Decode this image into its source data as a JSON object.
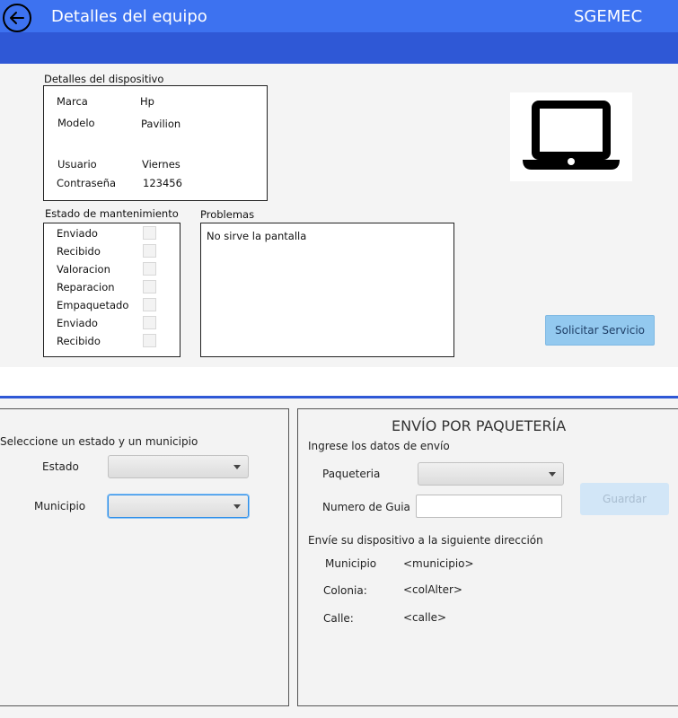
{
  "header": {
    "back_label": "back",
    "title": "Detalles del equipo",
    "brand": "SGEMEC"
  },
  "device": {
    "section_label": "Detalles del dispositivo",
    "marca_label": "Marca",
    "marca_value": "Hp",
    "modelo_label": "Modelo",
    "modelo_value": "Pavilion",
    "usuario_label": "Usuario",
    "usuario_value": "Viernes",
    "password_label": "Contraseña",
    "password_value": "123456",
    "image_icon": "laptop-icon"
  },
  "maintenance": {
    "section_label": "Estado de mantenimiento",
    "steps": [
      {
        "label": "Enviado",
        "checked": false
      },
      {
        "label": "Recibido",
        "checked": false
      },
      {
        "label": "Valoracion",
        "checked": false
      },
      {
        "label": "Reparacion",
        "checked": false
      },
      {
        "label": "Empaquetado",
        "checked": false
      },
      {
        "label": "Enviado",
        "checked": false
      },
      {
        "label": "Recibido",
        "checked": false
      }
    ]
  },
  "problems": {
    "section_label": "Problemas",
    "text": "No sirve la pantalla"
  },
  "actions": {
    "solicitar_label": "Solicitar Servicio"
  },
  "location": {
    "prompt": "Seleccione un estado y un municipio",
    "estado_label": "Estado",
    "estado_value": "",
    "municipio_label": "Municipio",
    "municipio_value": ""
  },
  "shipping": {
    "title": "ENVÍO POR PAQUETERÍA",
    "prompt": "Ingrese los datos de envío",
    "paqueteria_label": "Paqueteria",
    "paqueteria_value": "",
    "guia_label": "Numero de Guia",
    "guia_value": "",
    "guardar_label": "Guardar",
    "address_prompt": "Envíe su dispositivo a la siguiente dirección",
    "municipio_label": "Municipio",
    "municipio_value": "<municipio>",
    "colonia_label": "Colonia:",
    "colonia_value": "<colAlter>",
    "calle_label": "Calle:",
    "calle_value": "<calle>"
  },
  "colors": {
    "header": "#3d72f0",
    "subbar": "#2f58d6",
    "button": "#93c9ef"
  }
}
